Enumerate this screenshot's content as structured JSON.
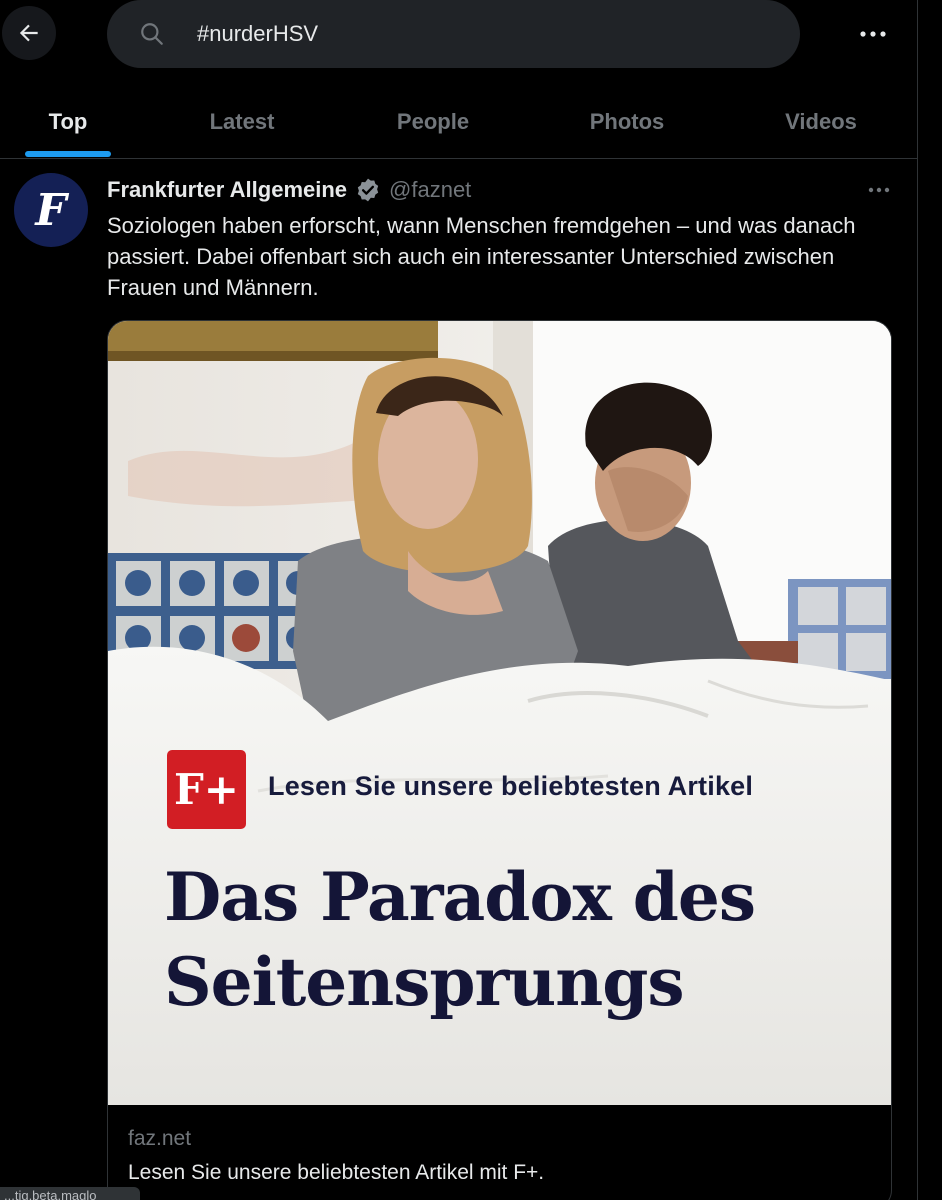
{
  "header": {
    "search_value": "#nurderHSV"
  },
  "tabs": [
    {
      "label": "Top",
      "active": true
    },
    {
      "label": "Latest",
      "active": false
    },
    {
      "label": "People",
      "active": false
    },
    {
      "label": "Photos",
      "active": false
    },
    {
      "label": "Videos",
      "active": false
    }
  ],
  "tweet": {
    "avatar_letter": "F",
    "author": "Frankfurter Allgemeine",
    "handle": "@faznet",
    "text": "Soziologen haben erforscht, wann Menschen fremdgehen – und was danach passiert. Dabei offenbart sich auch ein interessanter Unterschied zwischen Frauen und Männern.",
    "card": {
      "badge": "F+",
      "promo": "Lesen Sie unsere beliebtesten Artikel",
      "headline_line1": "Das Paradox des",
      "headline_line2": "Seitensprungs",
      "domain": "faz.net",
      "description": "Lesen Sie unsere beliebtesten Artikel mit F+."
    }
  },
  "footer_fragment": "...tig.beta.maglo",
  "colors": {
    "accent": "#1d9bf0",
    "faz_red": "#d21e24",
    "avatar_bg": "#142055"
  }
}
